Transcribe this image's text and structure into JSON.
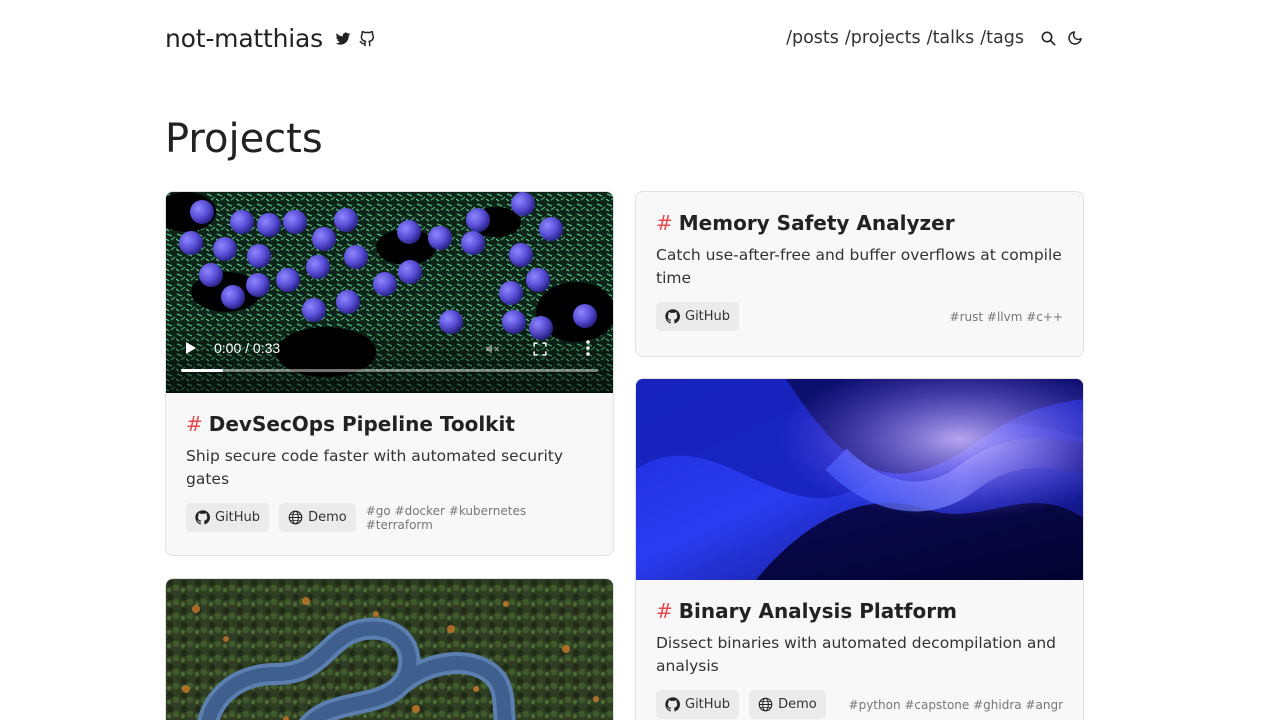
{
  "site": {
    "name": "not-matthias",
    "social_icons": [
      "twitter-icon",
      "github-icon"
    ]
  },
  "nav": {
    "links": [
      "/posts",
      "/projects",
      "/talks",
      "/tags"
    ],
    "icons": [
      "search-icon",
      "moon-icon"
    ]
  },
  "page": {
    "title": "Projects"
  },
  "colors": {
    "accent": "#e5484d",
    "card_bg": "#f8f8f8",
    "pill_bg": "#ebebeb"
  },
  "projects": [
    {
      "title": "DevSecOps Pipeline Toolkit",
      "hash": "#",
      "description": "Ship secure code faster with automated security gates",
      "github_label": "GitHub",
      "demo_label": "Demo",
      "tags": "#go #docker #kubernetes #terraform",
      "media": "video",
      "video": {
        "time": "0:00 / 0:33",
        "progress": 0.1
      }
    },
    {
      "title": "Memory Safety Analyzer",
      "hash": "#",
      "description": "Catch use-after-free and buffer overflows at compile time",
      "github_label": "GitHub",
      "tags": "#rust #llvm #c++",
      "media": "none"
    },
    {
      "title": "Binary Analysis Platform",
      "hash": "#",
      "description": "Dissect binaries with automated decompilation and analysis",
      "github_label": "GitHub",
      "demo_label": "Demo",
      "tags": "#python #capstone #ghidra #angr",
      "media": "abstract blue waves image"
    },
    {
      "media": "aerial winding road through forest image"
    }
  ]
}
